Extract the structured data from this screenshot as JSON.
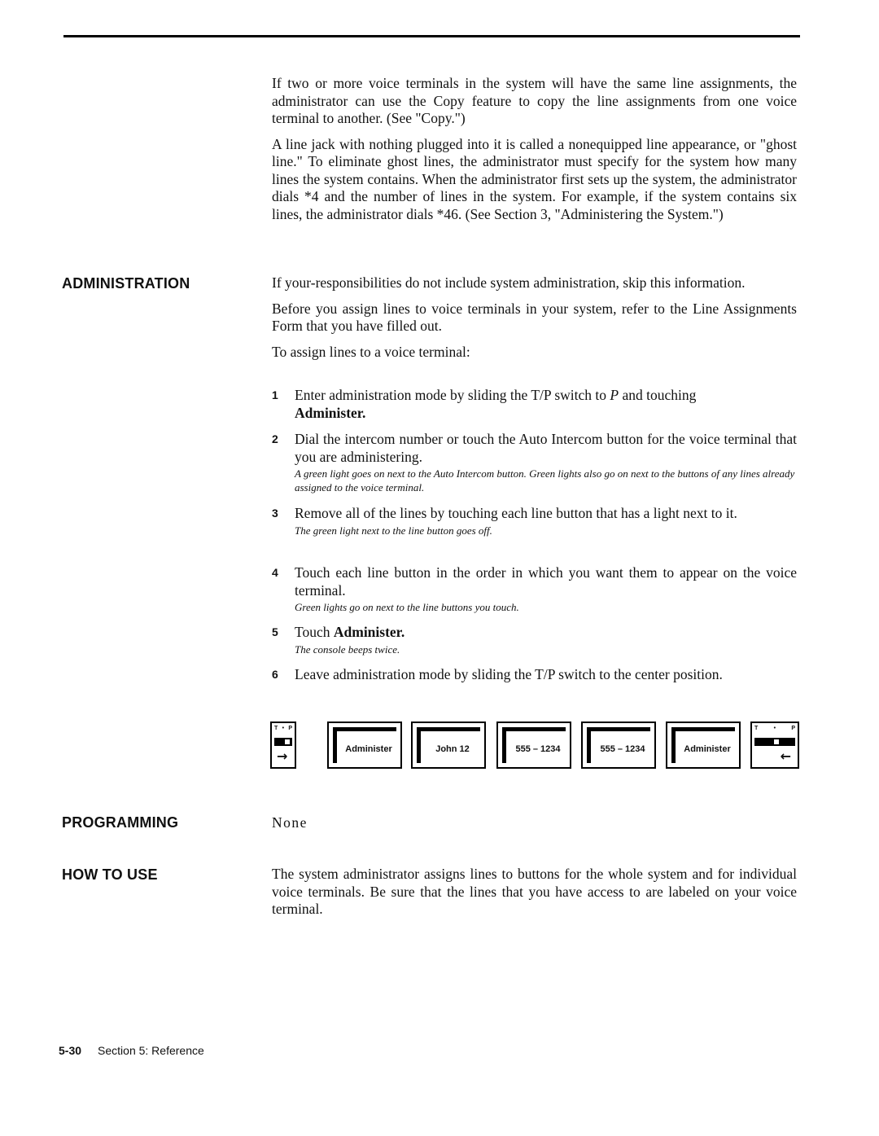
{
  "intro": {
    "p1": "If two or more voice terminals in the system will have the same line assignments, the administrator can use the Copy feature to copy the line assignments from one voice terminal to another. (See \"Copy.\")",
    "p2": "A line jack with nothing plugged into it is called a nonequipped line appearance, or \"ghost line.\" To eliminate ghost lines, the administrator must specify for the system how many lines the system contains. When the administrator first sets up the system, the administrator dials *4 and the number of lines in the system. For example, if the system contains six lines, the administrator dials *46. (See Section 3, \"Administering the System.\")"
  },
  "administration": {
    "heading": "ADMINISTRATION",
    "p1": "If your-responsibilities do not include system administration, skip this information.",
    "p2": "Before you assign lines to voice terminals in your system, refer to the Line Assignments Form that you have filled out.",
    "p3": "To assign lines to a voice terminal:",
    "steps": [
      {
        "num": "1",
        "text_a": "Enter administration mode by sliding the T/P switch to ",
        "text_italic": "P",
        "text_b": " and touching ",
        "text_bold": "Administer.",
        "note": ""
      },
      {
        "num": "2",
        "text": "Dial the intercom number or touch the Auto Intercom button for the voice terminal that you are administering.",
        "note": "A green light goes on next to the Auto Intercom button. Green lights also go on next to the buttons of any lines already assigned to the voice terminal."
      },
      {
        "num": "3",
        "text": "Remove all of the lines by touching each line button that has a light next to it.",
        "note": "The green light next to the line button goes off."
      },
      {
        "num": "4",
        "text": "Touch each line button in the order in which you want them to appear on the voice terminal.",
        "note": "Green lights go on next to the line buttons you touch."
      },
      {
        "num": "5",
        "text_a": "Touch ",
        "text_bold": "Administer.",
        "note": "The console beeps twice."
      },
      {
        "num": "6",
        "text": "Leave administration mode by sliding the T/P switch to the center position.",
        "note": ""
      }
    ],
    "illustration": {
      "switch_labels": {
        "t": "T",
        "dot": "•",
        "p": "P"
      },
      "start_switch_arrow": "→",
      "end_switch_arrow": "←",
      "buttons": [
        "Administer",
        "John 12",
        "555 – 1234",
        "555 – 1234",
        "Administer"
      ]
    }
  },
  "programming": {
    "heading": "PROGRAMMING",
    "text": "None"
  },
  "how_to_use": {
    "heading": "HOW TO USE",
    "text": "The system administrator assigns lines to buttons for the whole system and for individual voice terminals. Be sure that the lines that you have access to are labeled on your voice terminal."
  },
  "footer": {
    "page_number": "5-30",
    "section": "Section 5: Reference"
  }
}
